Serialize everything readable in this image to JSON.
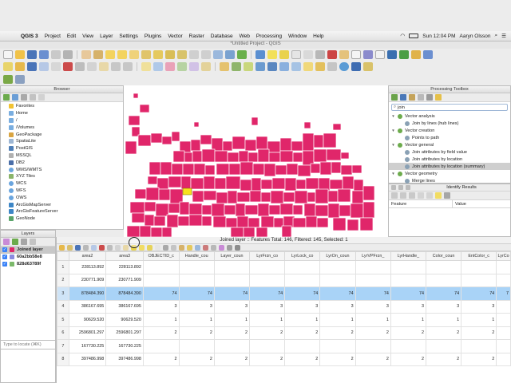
{
  "menubar": {
    "items": [
      "QGIS 3",
      "Project",
      "Edit",
      "View",
      "Layer",
      "Settings",
      "Plugins",
      "Vector",
      "Raster",
      "Database",
      "Web",
      "Processing",
      "Window",
      "Help"
    ],
    "clock": "Sun 12:04 PM",
    "user": "Aaryn Olsson"
  },
  "window": {
    "title": "*Untitled Project - QGIS"
  },
  "browser": {
    "title": "Browser",
    "items": [
      "Favorites",
      "Home",
      "/",
      "/Volumes",
      "GeoPackage",
      "SpatiaLite",
      "PostGIS",
      "MSSQL",
      "DB2",
      "WMS/WMTS",
      "XYZ Tiles",
      "WCS",
      "WFS",
      "OWS",
      "ArcGisMapServer",
      "ArcGisFeatureServer",
      "GeoNode"
    ]
  },
  "layers": {
    "title": "Layers",
    "items": [
      "Joined layer",
      "60a2bb58e8",
      "828d63789f"
    ],
    "locator_placeholder": "Type to locate (⌘K)"
  },
  "toolbox": {
    "title": "Processing Toolbox",
    "search": "join",
    "groups": [
      {
        "name": "Vector analysis",
        "algs": [
          "Join by lines (hub lines)"
        ]
      },
      {
        "name": "Vector creation",
        "algs": [
          "Points to path"
        ]
      },
      {
        "name": "Vector general",
        "algs": [
          "Join attributes by field value",
          "Join attributes by location",
          "Join attributes by location (summary)"
        ]
      },
      {
        "name": "Vector geometry",
        "algs": [
          "Merge lines"
        ]
      }
    ]
  },
  "identify": {
    "title": "Identify Results",
    "col_feature": "Feature",
    "col_value": "Value"
  },
  "attr_table": {
    "title": "Joined layer :: Features Total: 146, Filtered: 145, Selected: 1",
    "columns": [
      "area2",
      "area3",
      "OBJECTID_c",
      "Handle_cou",
      "Layer_coun",
      "LyrFrzn_co",
      "LyrLock_co",
      "LyrOn_coun",
      "LyrVPFrzn_",
      "LyrHandle_",
      "Color_coun",
      "EntColor_c",
      "LyrCo"
    ],
    "rows": [
      {
        "n": "1",
        "cells": [
          "228113.892",
          "228113.892",
          "",
          "",
          "",
          "",
          "",
          "",
          "",
          "",
          "",
          "",
          ""
        ]
      },
      {
        "n": "2",
        "cells": [
          "230771.909",
          "230771.909",
          "",
          "",
          "",
          "",
          "",
          "",
          "",
          "",
          "",
          "",
          ""
        ]
      },
      {
        "n": "3",
        "cells": [
          "878484.390",
          "878484.390",
          "74",
          "74",
          "74",
          "74",
          "74",
          "74",
          "74",
          "74",
          "74",
          "74",
          "7"
        ],
        "selected": true
      },
      {
        "n": "4",
        "cells": [
          "386167.695",
          "386167.695",
          "3",
          "3",
          "3",
          "3",
          "3",
          "3",
          "3",
          "3",
          "3",
          "3",
          ""
        ]
      },
      {
        "n": "5",
        "cells": [
          "90629.520",
          "90629.520",
          "1",
          "1",
          "1",
          "1",
          "1",
          "1",
          "1",
          "1",
          "1",
          "1",
          ""
        ]
      },
      {
        "n": "6",
        "cells": [
          "2596801.297",
          "2596801.297",
          "2",
          "2",
          "2",
          "2",
          "2",
          "2",
          "2",
          "2",
          "2",
          "2",
          ""
        ]
      },
      {
        "n": "7",
        "cells": [
          "167730.225",
          "167730.225",
          "",
          "",
          "",
          "",
          "",
          "",
          "",
          "",
          "",
          "",
          ""
        ]
      },
      {
        "n": "8",
        "cells": [
          "397486.998",
          "397486.998",
          "2",
          "2",
          "2",
          "2",
          "2",
          "2",
          "2",
          "2",
          "2",
          "2",
          ""
        ]
      }
    ]
  },
  "colors": {
    "polygon_fill": "#e0266a",
    "selected_fill": "#f7e01c",
    "selection_row": "#a9d3f7"
  }
}
